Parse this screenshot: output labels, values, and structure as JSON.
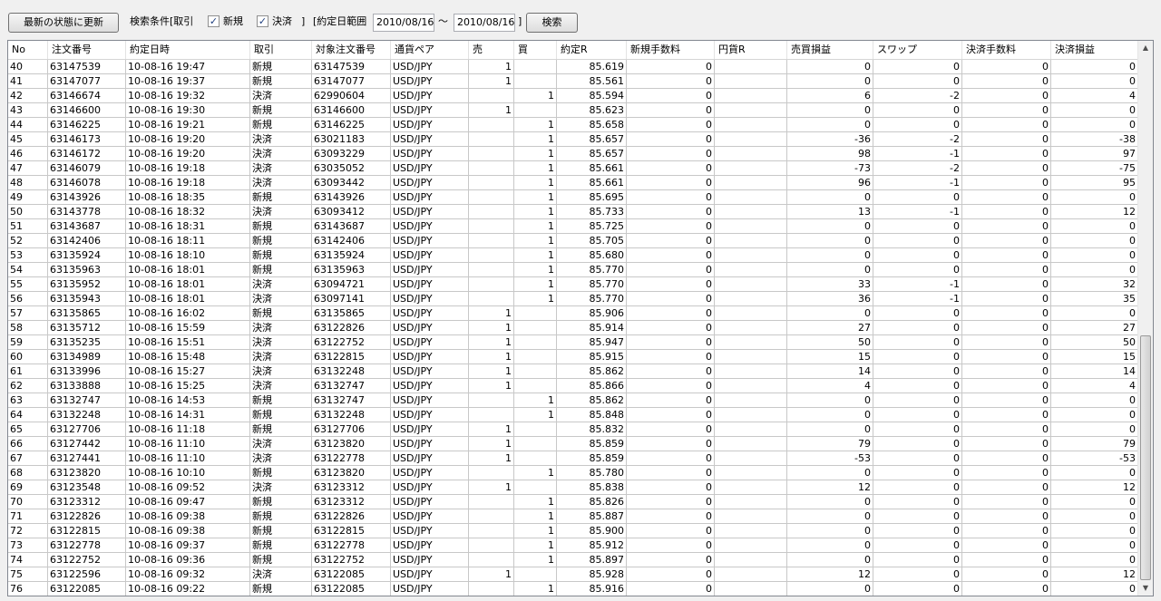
{
  "toolbar": {
    "refresh_label": "最新の状態に更新",
    "search_cond_label": "検索条件[取引",
    "chk_new_label": "新規",
    "chk_settle_label": "決済",
    "bracket_label": "]",
    "range_label": "[約定日範囲",
    "date_from": "2010/08/16",
    "tilde": "〜",
    "date_to": "2010/08/16",
    "range_close": "]",
    "search_label": "検索",
    "checkbox_glyph": "✓"
  },
  "icons": {
    "scroll_up": "scroll-up-arrow-icon",
    "scroll_down": "scroll-down-arrow-icon",
    "up_glyph": "▲",
    "down_glyph": "▼"
  },
  "table": {
    "headers": [
      "No",
      "注文番号",
      "約定日時",
      "取引",
      "対象注文番号",
      "通貨ペア",
      "売",
      "買",
      "約定R",
      "新規手数料",
      "円貨R",
      "売買損益",
      "スワップ",
      "決済手数料",
      "決済損益"
    ],
    "rows": [
      [
        "40",
        "63147539",
        "10-08-16 19:47",
        "新規",
        "63147539",
        "USD/JPY",
        "1",
        "",
        "85.619",
        "0",
        "",
        "0",
        "0",
        "0",
        "0"
      ],
      [
        "41",
        "63147077",
        "10-08-16 19:37",
        "新規",
        "63147077",
        "USD/JPY",
        "1",
        "",
        "85.561",
        "0",
        "",
        "0",
        "0",
        "0",
        "0"
      ],
      [
        "42",
        "63146674",
        "10-08-16 19:32",
        "決済",
        "62990604",
        "USD/JPY",
        "",
        "1",
        "85.594",
        "0",
        "",
        "6",
        "-2",
        "0",
        "4"
      ],
      [
        "43",
        "63146600",
        "10-08-16 19:30",
        "新規",
        "63146600",
        "USD/JPY",
        "1",
        "",
        "85.623",
        "0",
        "",
        "0",
        "0",
        "0",
        "0"
      ],
      [
        "44",
        "63146225",
        "10-08-16 19:21",
        "新規",
        "63146225",
        "USD/JPY",
        "",
        "1",
        "85.658",
        "0",
        "",
        "0",
        "0",
        "0",
        "0"
      ],
      [
        "45",
        "63146173",
        "10-08-16 19:20",
        "決済",
        "63021183",
        "USD/JPY",
        "",
        "1",
        "85.657",
        "0",
        "",
        "-36",
        "-2",
        "0",
        "-38"
      ],
      [
        "46",
        "63146172",
        "10-08-16 19:20",
        "決済",
        "63093229",
        "USD/JPY",
        "",
        "1",
        "85.657",
        "0",
        "",
        "98",
        "-1",
        "0",
        "97"
      ],
      [
        "47",
        "63146079",
        "10-08-16 19:18",
        "決済",
        "63035052",
        "USD/JPY",
        "",
        "1",
        "85.661",
        "0",
        "",
        "-73",
        "-2",
        "0",
        "-75"
      ],
      [
        "48",
        "63146078",
        "10-08-16 19:18",
        "決済",
        "63093442",
        "USD/JPY",
        "",
        "1",
        "85.661",
        "0",
        "",
        "96",
        "-1",
        "0",
        "95"
      ],
      [
        "49",
        "63143926",
        "10-08-16 18:35",
        "新規",
        "63143926",
        "USD/JPY",
        "",
        "1",
        "85.695",
        "0",
        "",
        "0",
        "0",
        "0",
        "0"
      ],
      [
        "50",
        "63143778",
        "10-08-16 18:32",
        "決済",
        "63093412",
        "USD/JPY",
        "",
        "1",
        "85.733",
        "0",
        "",
        "13",
        "-1",
        "0",
        "12"
      ],
      [
        "51",
        "63143687",
        "10-08-16 18:31",
        "新規",
        "63143687",
        "USD/JPY",
        "",
        "1",
        "85.725",
        "0",
        "",
        "0",
        "0",
        "0",
        "0"
      ],
      [
        "52",
        "63142406",
        "10-08-16 18:11",
        "新規",
        "63142406",
        "USD/JPY",
        "",
        "1",
        "85.705",
        "0",
        "",
        "0",
        "0",
        "0",
        "0"
      ],
      [
        "53",
        "63135924",
        "10-08-16 18:10",
        "新規",
        "63135924",
        "USD/JPY",
        "",
        "1",
        "85.680",
        "0",
        "",
        "0",
        "0",
        "0",
        "0"
      ],
      [
        "54",
        "63135963",
        "10-08-16 18:01",
        "新規",
        "63135963",
        "USD/JPY",
        "",
        "1",
        "85.770",
        "0",
        "",
        "0",
        "0",
        "0",
        "0"
      ],
      [
        "55",
        "63135952",
        "10-08-16 18:01",
        "決済",
        "63094721",
        "USD/JPY",
        "",
        "1",
        "85.770",
        "0",
        "",
        "33",
        "-1",
        "0",
        "32"
      ],
      [
        "56",
        "63135943",
        "10-08-16 18:01",
        "決済",
        "63097141",
        "USD/JPY",
        "",
        "1",
        "85.770",
        "0",
        "",
        "36",
        "-1",
        "0",
        "35"
      ],
      [
        "57",
        "63135865",
        "10-08-16 16:02",
        "新規",
        "63135865",
        "USD/JPY",
        "1",
        "",
        "85.906",
        "0",
        "",
        "0",
        "0",
        "0",
        "0"
      ],
      [
        "58",
        "63135712",
        "10-08-16 15:59",
        "決済",
        "63122826",
        "USD/JPY",
        "1",
        "",
        "85.914",
        "0",
        "",
        "27",
        "0",
        "0",
        "27"
      ],
      [
        "59",
        "63135235",
        "10-08-16 15:51",
        "決済",
        "63122752",
        "USD/JPY",
        "1",
        "",
        "85.947",
        "0",
        "",
        "50",
        "0",
        "0",
        "50"
      ],
      [
        "60",
        "63134989",
        "10-08-16 15:48",
        "決済",
        "63122815",
        "USD/JPY",
        "1",
        "",
        "85.915",
        "0",
        "",
        "15",
        "0",
        "0",
        "15"
      ],
      [
        "61",
        "63133996",
        "10-08-16 15:27",
        "決済",
        "63132248",
        "USD/JPY",
        "1",
        "",
        "85.862",
        "0",
        "",
        "14",
        "0",
        "0",
        "14"
      ],
      [
        "62",
        "63133888",
        "10-08-16 15:25",
        "決済",
        "63132747",
        "USD/JPY",
        "1",
        "",
        "85.866",
        "0",
        "",
        "4",
        "0",
        "0",
        "4"
      ],
      [
        "63",
        "63132747",
        "10-08-16 14:53",
        "新規",
        "63132747",
        "USD/JPY",
        "",
        "1",
        "85.862",
        "0",
        "",
        "0",
        "0",
        "0",
        "0"
      ],
      [
        "64",
        "63132248",
        "10-08-16 14:31",
        "新規",
        "63132248",
        "USD/JPY",
        "",
        "1",
        "85.848",
        "0",
        "",
        "0",
        "0",
        "0",
        "0"
      ],
      [
        "65",
        "63127706",
        "10-08-16 11:18",
        "新規",
        "63127706",
        "USD/JPY",
        "1",
        "",
        "85.832",
        "0",
        "",
        "0",
        "0",
        "0",
        "0"
      ],
      [
        "66",
        "63127442",
        "10-08-16 11:10",
        "決済",
        "63123820",
        "USD/JPY",
        "1",
        "",
        "85.859",
        "0",
        "",
        "79",
        "0",
        "0",
        "79"
      ],
      [
        "67",
        "63127441",
        "10-08-16 11:10",
        "決済",
        "63122778",
        "USD/JPY",
        "1",
        "",
        "85.859",
        "0",
        "",
        "-53",
        "0",
        "0",
        "-53"
      ],
      [
        "68",
        "63123820",
        "10-08-16 10:10",
        "新規",
        "63123820",
        "USD/JPY",
        "",
        "1",
        "85.780",
        "0",
        "",
        "0",
        "0",
        "0",
        "0"
      ],
      [
        "69",
        "63123548",
        "10-08-16 09:52",
        "決済",
        "63123312",
        "USD/JPY",
        "1",
        "",
        "85.838",
        "0",
        "",
        "12",
        "0",
        "0",
        "12"
      ],
      [
        "70",
        "63123312",
        "10-08-16 09:47",
        "新規",
        "63123312",
        "USD/JPY",
        "",
        "1",
        "85.826",
        "0",
        "",
        "0",
        "0",
        "0",
        "0"
      ],
      [
        "71",
        "63122826",
        "10-08-16 09:38",
        "新規",
        "63122826",
        "USD/JPY",
        "",
        "1",
        "85.887",
        "0",
        "",
        "0",
        "0",
        "0",
        "0"
      ],
      [
        "72",
        "63122815",
        "10-08-16 09:38",
        "新規",
        "63122815",
        "USD/JPY",
        "",
        "1",
        "85.900",
        "0",
        "",
        "0",
        "0",
        "0",
        "0"
      ],
      [
        "73",
        "63122778",
        "10-08-16 09:37",
        "新規",
        "63122778",
        "USD/JPY",
        "",
        "1",
        "85.912",
        "0",
        "",
        "0",
        "0",
        "0",
        "0"
      ],
      [
        "74",
        "63122752",
        "10-08-16 09:36",
        "新規",
        "63122752",
        "USD/JPY",
        "",
        "1",
        "85.897",
        "0",
        "",
        "0",
        "0",
        "0",
        "0"
      ],
      [
        "75",
        "63122596",
        "10-08-16 09:32",
        "決済",
        "63122085",
        "USD/JPY",
        "1",
        "",
        "85.928",
        "0",
        "",
        "12",
        "0",
        "0",
        "12"
      ],
      [
        "76",
        "63122085",
        "10-08-16 09:22",
        "新規",
        "63122085",
        "USD/JPY",
        "",
        "1",
        "85.916",
        "0",
        "",
        "0",
        "0",
        "0",
        "0"
      ]
    ]
  }
}
